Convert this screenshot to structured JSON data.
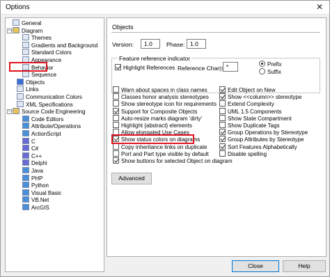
{
  "window": {
    "title": "Options",
    "close_glyph": "✕"
  },
  "tree": {
    "items": [
      {
        "label": "General",
        "icon": "page-icon"
      },
      {
        "label": "Diagram",
        "icon": "folder-icon",
        "toggle": "−"
      },
      {
        "label": "Themes",
        "icon": "page-icon"
      },
      {
        "label": "Gradients and Background",
        "icon": "page-icon"
      },
      {
        "label": "Standard Colors",
        "icon": "page-icon"
      },
      {
        "label": "Appearance",
        "icon": "page-icon"
      },
      {
        "label": "Behavior",
        "icon": "page-icon"
      },
      {
        "label": "Sequence",
        "icon": "page-icon"
      },
      {
        "label": "Objects",
        "icon": "objects-icon",
        "selected": true
      },
      {
        "label": "Links",
        "icon": "page-icon"
      },
      {
        "label": "Communication Colors",
        "icon": "page-icon"
      },
      {
        "label": "XML Specifications",
        "icon": "page-icon"
      },
      {
        "label": "Source Code Engineering",
        "icon": "folder-icon",
        "toggle": "−"
      },
      {
        "label": "Code Editors",
        "icon": "code-icon"
      },
      {
        "label": "Attribute/Operations",
        "icon": "code-icon"
      },
      {
        "label": "ActionScript",
        "icon": "code-icon"
      },
      {
        "label": "C",
        "icon": "c-icon"
      },
      {
        "label": "C#",
        "icon": "c-icon"
      },
      {
        "label": "C++",
        "icon": "c-icon"
      },
      {
        "label": "Delphi",
        "icon": "c-icon"
      },
      {
        "label": "Java",
        "icon": "code-icon"
      },
      {
        "label": "PHP",
        "icon": "code-icon"
      },
      {
        "label": "Python",
        "icon": "code-icon"
      },
      {
        "label": "Visual Basic",
        "icon": "code-icon"
      },
      {
        "label": "VB.Net",
        "icon": "code-icon"
      },
      {
        "label": "ArcGIS",
        "icon": "code-icon"
      }
    ]
  },
  "panel": {
    "title": "Objects",
    "version_label": "Version:",
    "version_value": "1.0",
    "phase_label": "Phase:",
    "phase_value": "1.0",
    "group_title": "Feature reference indicator",
    "highlight_refs_label": "Highlight References",
    "highlight_refs_checked": true,
    "ref_char_label": "Reference Char(s)",
    "ref_char_value": "*",
    "prefix_label": "Prefix",
    "suffix_label": "Suffix",
    "prefix_selected": true,
    "left_options": [
      {
        "label": "Warn about spaces in class names",
        "checked": false
      },
      {
        "label": "Classes honor analysis stereotypes",
        "checked": false
      },
      {
        "label": "Show stereotype icon for requirements",
        "checked": false
      },
      {
        "label": "Support for Composite Objects",
        "checked": true
      },
      {
        "label": "Auto-resize marks diagram 'dirty'",
        "checked": false
      },
      {
        "label": "Highlight {abstract} elements",
        "checked": false
      },
      {
        "label": "Allow elongated Use Cases",
        "checked": false
      },
      {
        "label": "Show status colors on diagrams",
        "checked": true
      },
      {
        "label": "Copy inheritance links on duplicate",
        "checked": false
      },
      {
        "label": "Port and Part type visible by default",
        "checked": false
      },
      {
        "label": "Show buttons for selected Object on diagram",
        "checked": true
      }
    ],
    "right_options": [
      {
        "label": "Edit Object on New",
        "checked": true
      },
      {
        "label": "Show <<column>> stereotype",
        "checked": true
      },
      {
        "label": "Extend Complexity",
        "checked": false
      },
      {
        "label": "UML 1.5 Components",
        "checked": false
      },
      {
        "label": "Show State Compartment",
        "checked": false
      },
      {
        "label": "Show Duplicate Tags",
        "checked": false
      },
      {
        "label": "Group Operations by Stereotype",
        "checked": true
      },
      {
        "label": "Group Attributes by Stereotype",
        "checked": true
      },
      {
        "label": "Sort Features Alphabetically",
        "checked": true
      },
      {
        "label": "Disable spelling",
        "checked": false
      }
    ],
    "advanced_label": "Advanced"
  },
  "footer": {
    "close_label": "Close",
    "help_label": "Help"
  },
  "colors": {
    "highlight": "#e0141e",
    "folder": "#e8c25a",
    "accent": "#0078d7"
  }
}
